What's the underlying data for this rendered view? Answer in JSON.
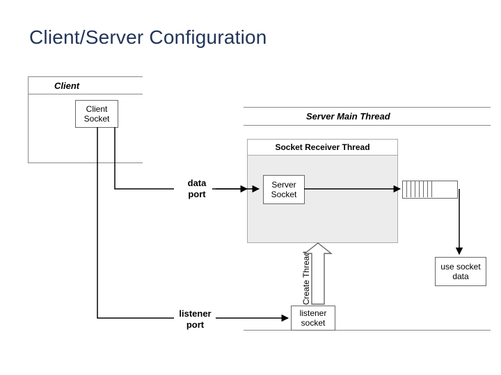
{
  "title": "Client/Server Configuration",
  "labels": {
    "client": "Client",
    "server_main": "Server Main Thread",
    "client_socket": "Client\nSocket",
    "data_port": "data\nport",
    "server_socket": "Server\nSocket",
    "socket_receiver": "Socket Receiver Thread",
    "use_socket_data": "use socket\ndata",
    "listener_port": "listener\nport",
    "listener_socket": "listener\nsocket",
    "create_thread": "Create\nThread"
  },
  "chart_data": {
    "type": "diagram",
    "title": "Client/Server Configuration",
    "nodes": [
      {
        "id": "client",
        "label": "Client",
        "type": "section"
      },
      {
        "id": "client_socket",
        "label": "Client Socket",
        "type": "box",
        "parent": "client"
      },
      {
        "id": "server_main",
        "label": "Server Main Thread",
        "type": "section"
      },
      {
        "id": "receiver",
        "label": "Socket Receiver Thread",
        "type": "section",
        "parent": "server_main"
      },
      {
        "id": "server_socket",
        "label": "Server Socket",
        "type": "box",
        "parent": "receiver"
      },
      {
        "id": "queue",
        "label": "queue",
        "type": "queue",
        "parent": "server_main"
      },
      {
        "id": "use_socket_data",
        "label": "use socket data",
        "type": "box",
        "parent": "server_main"
      },
      {
        "id": "listener_socket",
        "label": "listener socket",
        "type": "box",
        "parent": "server_main"
      },
      {
        "id": "data_port",
        "label": "data port",
        "type": "port"
      },
      {
        "id": "listener_port",
        "label": "listener port",
        "type": "port"
      }
    ],
    "edges": [
      {
        "from": "client_socket",
        "to": "data_port"
      },
      {
        "from": "data_port",
        "to": "server_socket"
      },
      {
        "from": "server_socket",
        "to": "queue"
      },
      {
        "from": "queue",
        "to": "use_socket_data"
      },
      {
        "from": "client_socket",
        "to": "listener_port"
      },
      {
        "from": "listener_port",
        "to": "listener_socket"
      },
      {
        "from": "listener_socket",
        "to": "receiver",
        "label": "Create Thread"
      }
    ]
  }
}
